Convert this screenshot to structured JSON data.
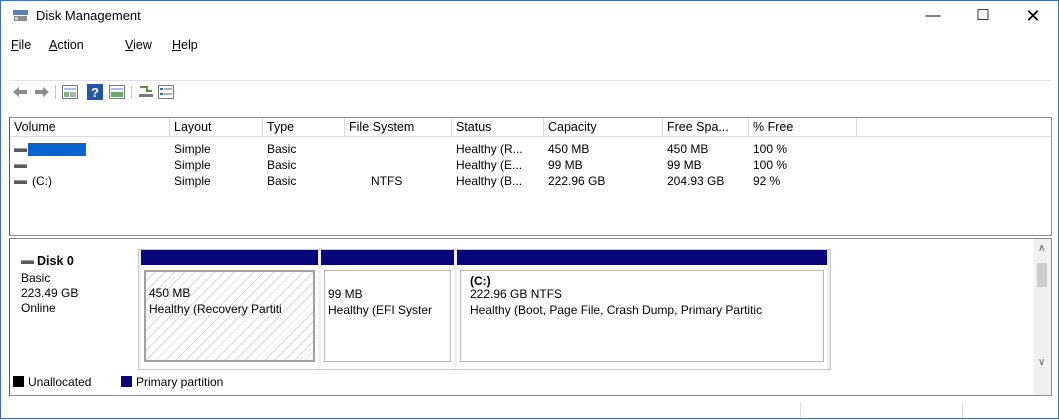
{
  "window": {
    "title": "Disk Management",
    "min_glyph": "—",
    "max_glyph": "☐",
    "close_glyph": "✕"
  },
  "menu": {
    "file": {
      "ul": "F",
      "rest": "ile"
    },
    "action": {
      "ul": "A",
      "rest": "ction"
    },
    "view": {
      "ul": "V",
      "rest": "iew"
    },
    "help": {
      "ul": "H",
      "rest": "elp"
    }
  },
  "toolbar": {
    "icons": [
      "back-arrow-icon",
      "forward-arrow-icon",
      "disk-list-icon",
      "help-icon",
      "properties-icon",
      "rescan-icon",
      "settings-icon"
    ]
  },
  "volumes": {
    "columns": [
      "Volume",
      "Layout",
      "Type",
      "File System",
      "Status",
      "Capacity",
      "Free Spa...",
      "% Free"
    ],
    "rows": [
      {
        "volume": "",
        "layout": "Simple",
        "type": "Basic",
        "fs": "",
        "status": "Healthy (R...",
        "capacity": "450 MB",
        "free": "450 MB",
        "pct": "100 %"
      },
      {
        "volume": "",
        "layout": "Simple",
        "type": "Basic",
        "fs": "",
        "status": "Healthy (E...",
        "capacity": "99 MB",
        "free": "99 MB",
        "pct": "100 %"
      },
      {
        "volume": "(C:)",
        "layout": "Simple",
        "type": "Basic",
        "fs": "NTFS",
        "status": "Healthy (B...",
        "capacity": "222.96 GB",
        "free": "204.93 GB",
        "pct": "92 %"
      }
    ]
  },
  "disk": {
    "name": "Disk 0",
    "type": "Basic",
    "size": "223.49 GB",
    "state": "Online",
    "partitions": [
      {
        "label": "",
        "size": "450 MB",
        "status": "Healthy (Recovery Partiti"
      },
      {
        "label": "",
        "size": "99 MB",
        "status": "Healthy (EFI Syster"
      },
      {
        "label": "(C:)",
        "size": "222.96 GB NTFS",
        "status": "Healthy (Boot, Page File, Crash Dump, Primary Partitic"
      }
    ]
  },
  "legend": {
    "unallocated": "Unallocated",
    "primary": "Primary partition"
  },
  "colors": {
    "primary": "#08087a",
    "unallocated": "#000000",
    "selection": "#0a64d2"
  }
}
